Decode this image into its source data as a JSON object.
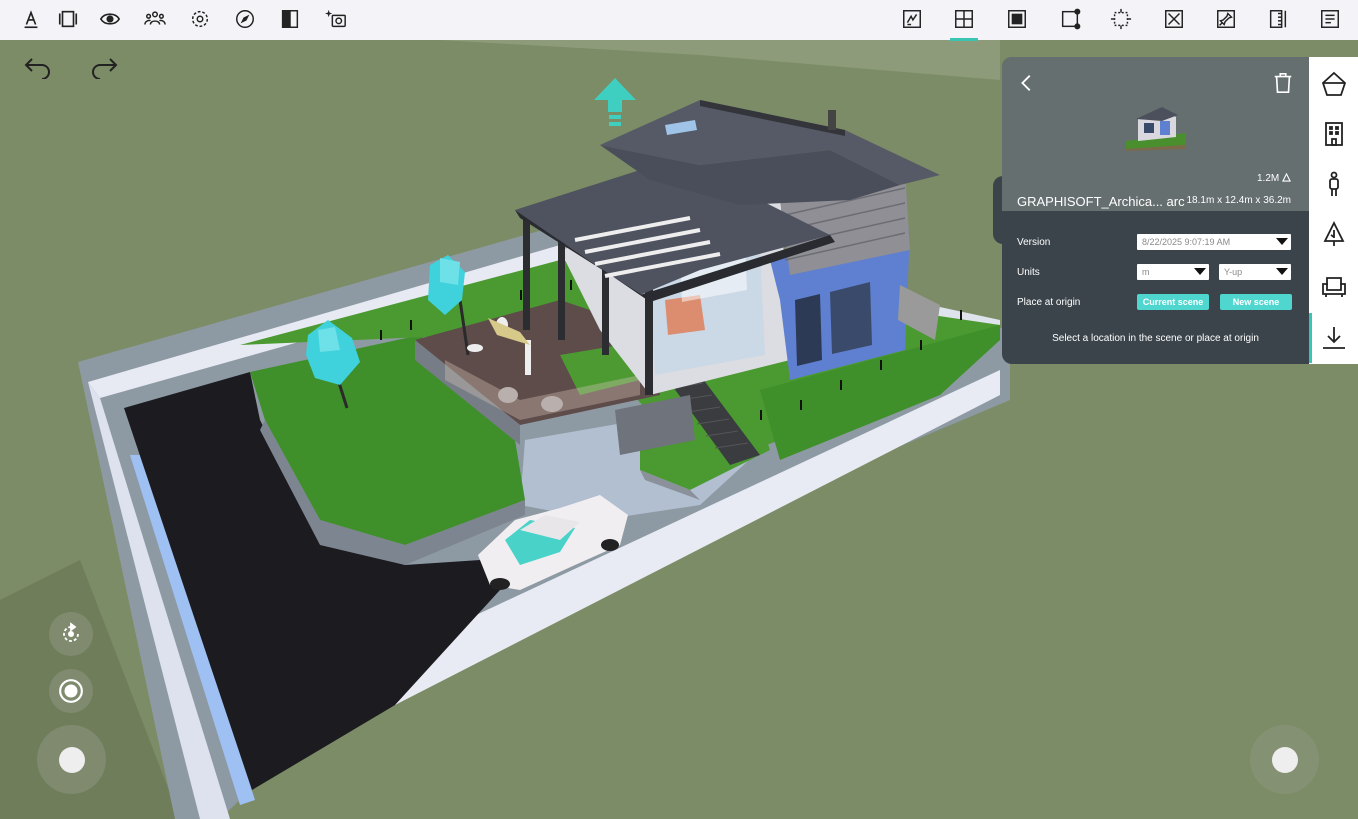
{
  "toolbar": {
    "left_icons": [
      "text-icon",
      "panels-icon",
      "eye-icon",
      "people-icon",
      "settings-icon",
      "compass-icon",
      "contrast-icon",
      "sparkle-camera-icon"
    ],
    "right_icons": [
      "draw-icon",
      "grid-view-icon",
      "stop-square-icon",
      "select-corners-icon",
      "crop-icon",
      "cross-box-icon",
      "pin-icon",
      "ruler-icon",
      "notes-icon"
    ],
    "active_right_icon": "grid-view-icon",
    "accent_color": "#38c5b3"
  },
  "history": {
    "undo_icon": "undo-icon",
    "redo_icon": "redo-icon"
  },
  "scene": {
    "north_arrow_icon": "north-arrow-icon",
    "ground_color": "#7c8c66"
  },
  "import_panel": {
    "poly_count": "1.2M",
    "model_name": "GRAPHISOFT_Archica... arc",
    "dimensions": "18.1m x 12.4m x 36.2m",
    "version_label": "Version",
    "version_value": "8/22/2025 9:07:19 AM",
    "units_label": "Units",
    "units_value": "m",
    "axis_value": "Y-up",
    "place_label": "Place at origin",
    "current_scene_button": "Current scene",
    "new_scene_button": "New scene",
    "hint": "Select a location in the scene or place at origin",
    "button_color": "#4fd6cf"
  },
  "sidebar": {
    "items": [
      "shapes-icon",
      "building-icon",
      "person-icon",
      "tree-icon",
      "armchair-icon",
      "download-icon"
    ],
    "active_item": "download-icon"
  },
  "controls": {
    "left_icons": [
      "rotate-icon",
      "record-icon"
    ]
  }
}
